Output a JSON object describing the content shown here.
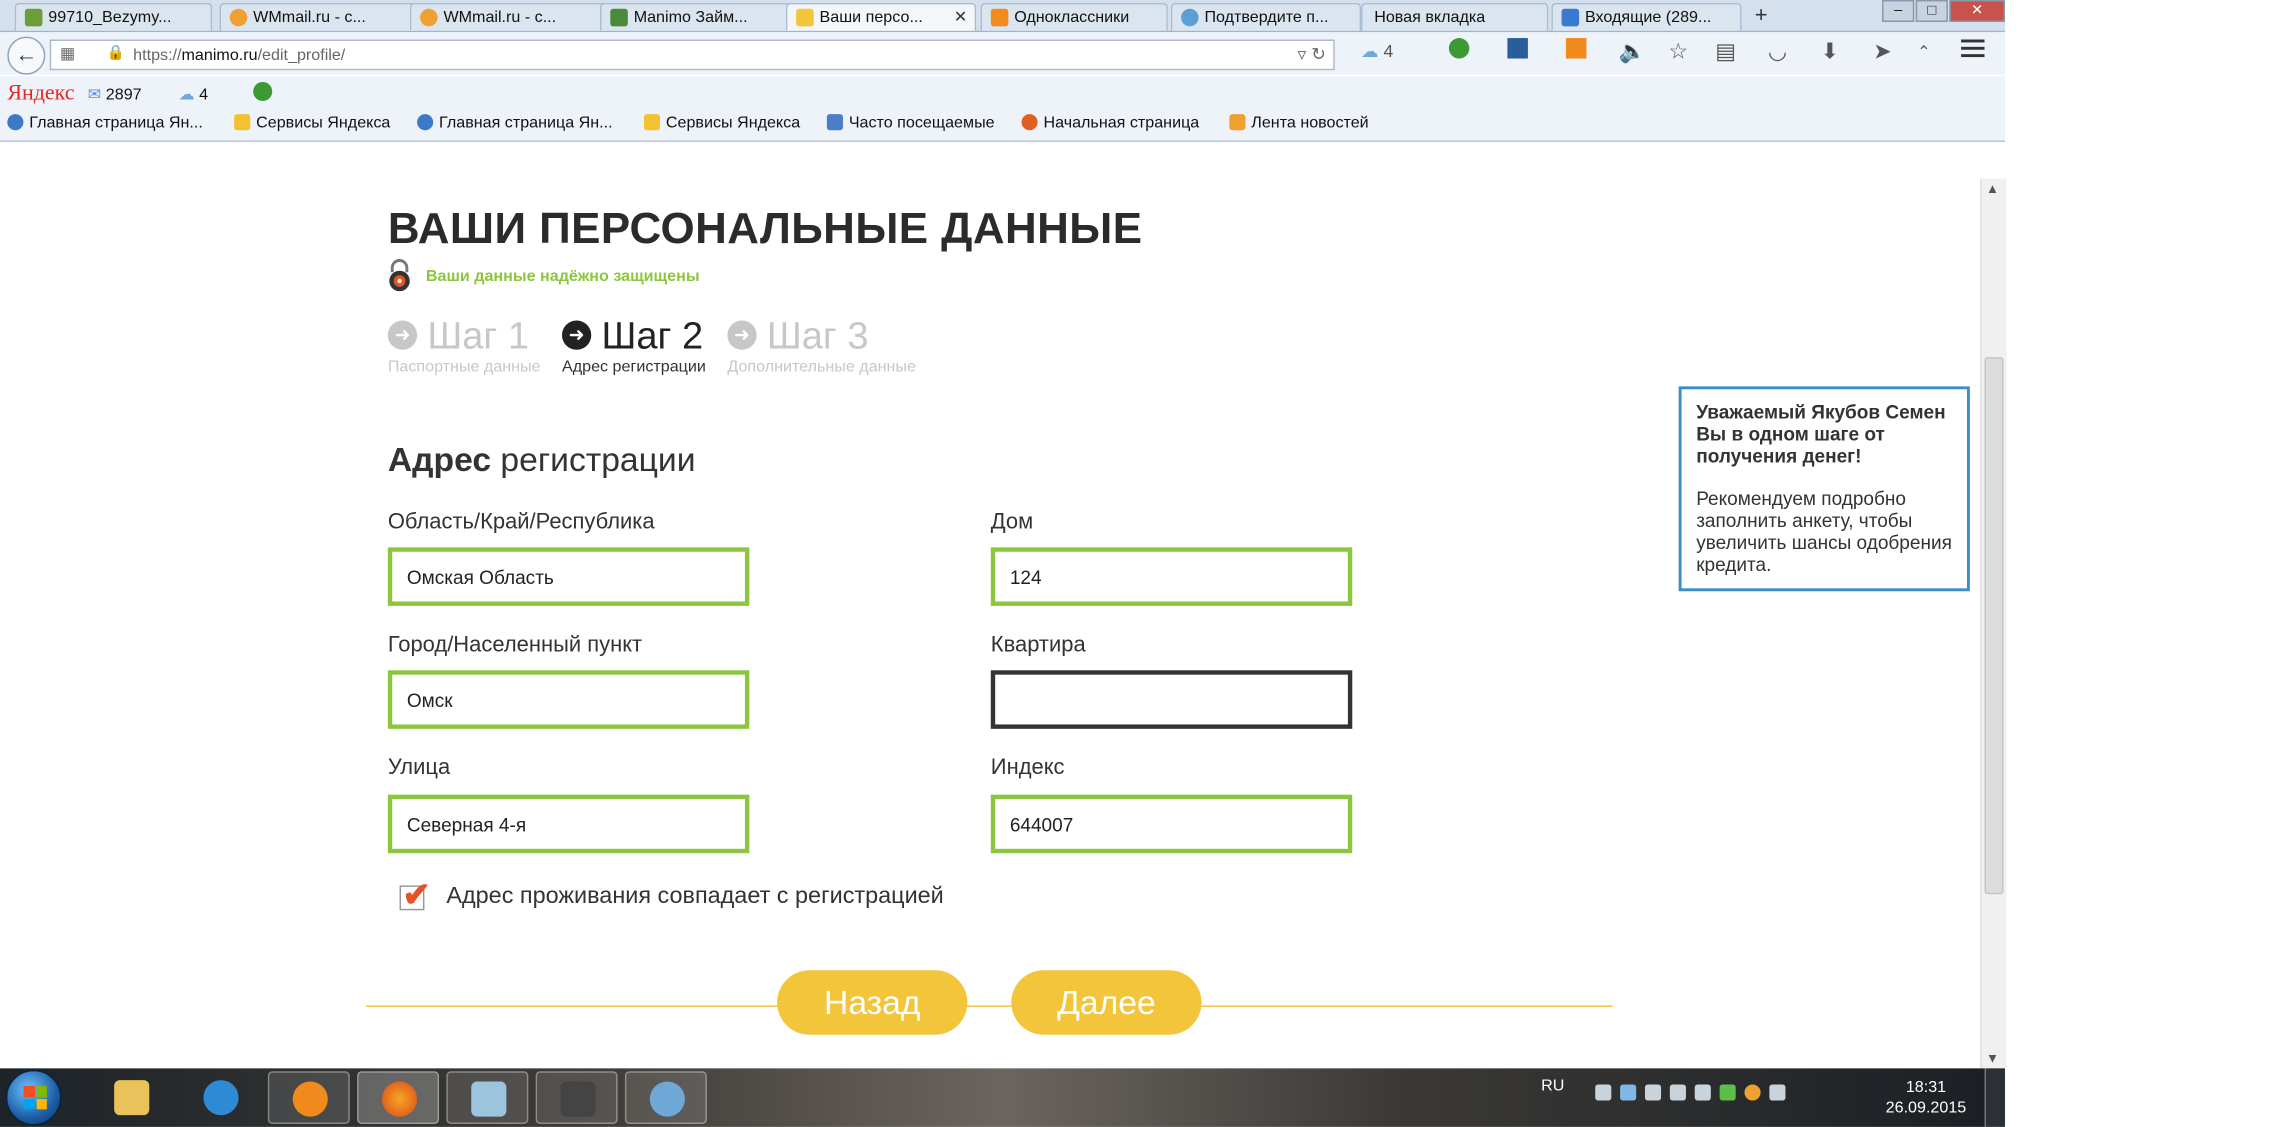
{
  "tabs": [
    {
      "label": "99710_Bezymy...",
      "color": "#6b9e3a"
    },
    {
      "label": "WMmail.ru - с...",
      "color": "#f0a030"
    },
    {
      "label": "WMmail.ru - с...",
      "color": "#f0a030"
    },
    {
      "label": "Manimo Займ...",
      "color": "#4a8a3a"
    },
    {
      "label": "Ваши персо...",
      "color": "#f3c53b",
      "active": true
    },
    {
      "label": "Одноклассники",
      "color": "#f28a1c"
    },
    {
      "label": "Подтвердите п...",
      "color": "#5aa0d6"
    },
    {
      "label": "Новая вкладка",
      "color": ""
    },
    {
      "label": "Входящие (289...",
      "color": "#3b7ad0"
    }
  ],
  "new_tab_icon": "+",
  "address": {
    "prefix": "https://",
    "host": "manimo.ru",
    "path": "/edit_profile/"
  },
  "toolbar": {
    "weather_count": "4"
  },
  "yandex": {
    "logo_main": "Яндекс",
    "mail_count": "2897",
    "weather": "4"
  },
  "bookmarks": [
    {
      "label": "Главная страница Ян...",
      "icon": "#3a7ac6"
    },
    {
      "label": "Сервисы Яндекса",
      "icon": "#f2c230"
    },
    {
      "label": "Главная страница Ян...",
      "icon": "#3a7ac6"
    },
    {
      "label": "Сервисы Яндекса",
      "icon": "#f2c230"
    },
    {
      "label": "Часто посещаемые",
      "icon": "#4a7fc8"
    },
    {
      "label": "Начальная страница",
      "icon": "#e06020"
    },
    {
      "label": "Лента новостей",
      "icon": "#f0a030"
    }
  ],
  "page": {
    "title": "ВАШИ ПЕРСОНАЛЬНЫЕ ДАННЫЕ",
    "secure_note": "Ваши данные надёжно защищены",
    "steps": [
      {
        "name": "Шаг 1",
        "sub": "Паспортные данные",
        "active": false
      },
      {
        "name": "Шаг 2",
        "sub": "Адрес регистрации",
        "active": true
      },
      {
        "name": "Шаг 3",
        "sub": "Дополнительные данные",
        "active": false
      }
    ],
    "section_title_bold": "Адрес",
    "section_title_rest": " регистрации",
    "fields": {
      "region": {
        "label": "Область/Край/Республика",
        "value": "Омская Область"
      },
      "city": {
        "label": "Город/Населенный пункт",
        "value": "Омск"
      },
      "street": {
        "label": "Улица",
        "value": "Северная 4-я"
      },
      "house": {
        "label": "Дом",
        "value": "124"
      },
      "apartment": {
        "label": "Квартира",
        "value": ""
      },
      "index": {
        "label": "Индекс",
        "value": "644007"
      }
    },
    "same_address_label": "Адрес проживания совпадает с регистрацией",
    "same_address_checked": true,
    "back_button": "Назад",
    "next_button": "Далее",
    "info": {
      "title": "Уважаемый Якубов Семен Вы в одном шаге от получения денег!",
      "text": "Рекомендуем подробно заполнить анкету, чтобы увеличить шансы одобрения кредита."
    },
    "accent_color": "#f3c53b",
    "valid_color": "#8cc63f"
  },
  "taskbar": {
    "language": "RU",
    "time": "18:31",
    "date": "26.09.2015"
  }
}
